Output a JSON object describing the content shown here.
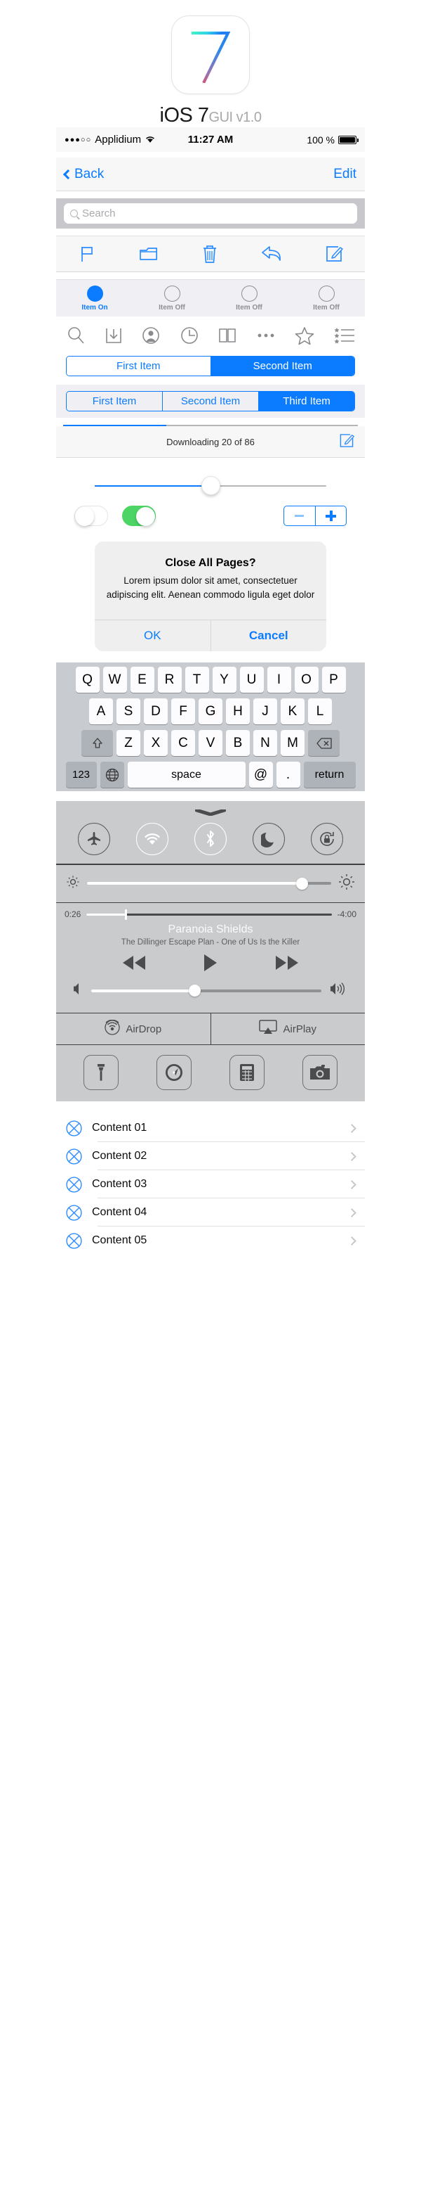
{
  "hero": {
    "logo_icon": "ios7-logo",
    "title_main": "iOS 7",
    "title_sub": "GUI v1.0"
  },
  "statusbar": {
    "signal_dots": "●●●○○",
    "carrier": "Applidium",
    "wifi_icon": "wifi-icon",
    "time": "11:27 AM",
    "battery_percent": "100 %",
    "battery_icon": "battery-full-icon"
  },
  "navbar": {
    "back_label": "Back",
    "back_icon": "chevron-left-icon",
    "edit_label": "Edit"
  },
  "search": {
    "placeholder": "Search",
    "icon": "search-icon",
    "value": ""
  },
  "toolbar": {
    "items": [
      {
        "name": "flag-icon",
        "label": "Flag"
      },
      {
        "name": "folder-icon",
        "label": "Folder"
      },
      {
        "name": "trash-icon",
        "label": "Trash"
      },
      {
        "name": "reply-icon",
        "label": "Reply"
      },
      {
        "name": "compose-icon",
        "label": "Compose"
      }
    ]
  },
  "tabbar": {
    "items": [
      {
        "label": "Item On",
        "state": "on"
      },
      {
        "label": "Item Off",
        "state": "off"
      },
      {
        "label": "Item Off",
        "state": "off"
      },
      {
        "label": "Item Off",
        "state": "off"
      }
    ]
  },
  "iconrow": {
    "items": [
      {
        "name": "search-icon",
        "label": "Search"
      },
      {
        "name": "share-download-icon",
        "label": "Share"
      },
      {
        "name": "contact-icon",
        "label": "Contact"
      },
      {
        "name": "history-clock-icon",
        "label": "History"
      },
      {
        "name": "bookmarks-book-icon",
        "label": "Bookmarks"
      },
      {
        "name": "more-dots-icon",
        "label": "More"
      },
      {
        "name": "star-icon",
        "label": "Favorite"
      },
      {
        "name": "reading-list-icon",
        "label": "Reading List"
      }
    ]
  },
  "segmented_two": {
    "options": [
      "First Item",
      "Second Item"
    ],
    "selected_index": 1
  },
  "segmented_three": {
    "options": [
      "First Item",
      "Second Item",
      "Third Item"
    ],
    "selected_index": 2
  },
  "progress": {
    "percent": 35,
    "status_text": "Downloading 20 of 86",
    "compose_icon": "compose-icon"
  },
  "slider": {
    "value_percent": 50
  },
  "controls": {
    "switch_off_state": "off",
    "switch_on_state": "on",
    "stepper_minus": "minus-icon",
    "stepper_plus": "plus-icon",
    "accent_blue": "#0b7cff",
    "switch_green": "#4cd564"
  },
  "alert": {
    "title": "Close All Pages?",
    "message": "Lorem ipsum dolor sit amet, consectetuer adipiscing elit. Aenean commodo ligula eget dolor",
    "ok_label": "OK",
    "cancel_label": "Cancel"
  },
  "keyboard": {
    "row1": [
      "Q",
      "W",
      "E",
      "R",
      "T",
      "Y",
      "U",
      "I",
      "O",
      "P"
    ],
    "row2": [
      "A",
      "S",
      "D",
      "F",
      "G",
      "H",
      "J",
      "K",
      "L"
    ],
    "row3_shift": "shift-icon",
    "row3": [
      "Z",
      "X",
      "C",
      "V",
      "B",
      "N",
      "M"
    ],
    "row3_delete": "delete-icon",
    "row4_num": "123",
    "row4_globe": "globe-icon",
    "row4_space": "space",
    "row4_at": "@",
    "row4_dot": ".",
    "row4_return": "return"
  },
  "control_center": {
    "grip_icon": "grabber-icon",
    "toggles": [
      {
        "name": "airplane-mode-icon",
        "label": "Airplane Mode",
        "active": false
      },
      {
        "name": "wifi-icon",
        "label": "Wi-Fi",
        "active": true
      },
      {
        "name": "bluetooth-icon",
        "label": "Bluetooth",
        "active": true
      },
      {
        "name": "do-not-disturb-moon-icon",
        "label": "Do Not Disturb",
        "active": false
      },
      {
        "name": "rotation-lock-icon",
        "label": "Rotation Lock",
        "active": false
      }
    ],
    "brightness": {
      "low_icon": "brightness-low-icon",
      "high_icon": "brightness-high-icon",
      "value_percent": 88
    },
    "music": {
      "elapsed": "0:26",
      "remaining": "-4:00",
      "progress_percent": 16,
      "track_title": "Paranoia Shields",
      "artist_album": "The Dillinger Escape Plan - One of Us Is the Killer",
      "previous_icon": "rewind-icon",
      "play_icon": "play-icon",
      "next_icon": "fast-forward-icon",
      "volume_percent": 45,
      "volume_low_icon": "volume-low-icon",
      "volume_high_icon": "volume-high-icon"
    },
    "airdrop_label": "AirDrop",
    "airdrop_icon": "airdrop-icon",
    "airplay_label": "AirPlay",
    "airplay_icon": "airplay-icon",
    "apps": [
      {
        "name": "flashlight-icon",
        "label": "Flashlight"
      },
      {
        "name": "timer-clock-icon",
        "label": "Timer"
      },
      {
        "name": "calculator-icon",
        "label": "Calculator"
      },
      {
        "name": "camera-icon",
        "label": "Camera"
      }
    ]
  },
  "content_list": {
    "rows": [
      {
        "label": "Content 01",
        "icon": "placeholder-x-icon",
        "chevron": "chevron-right-icon"
      },
      {
        "label": "Content 02",
        "icon": "placeholder-x-icon",
        "chevron": "chevron-right-icon"
      },
      {
        "label": "Content 03",
        "icon": "placeholder-x-icon",
        "chevron": "chevron-right-icon"
      },
      {
        "label": "Content 04",
        "icon": "placeholder-x-icon",
        "chevron": "chevron-right-icon"
      },
      {
        "label": "Content 05",
        "icon": "placeholder-x-icon",
        "chevron": "chevron-right-icon"
      }
    ]
  }
}
